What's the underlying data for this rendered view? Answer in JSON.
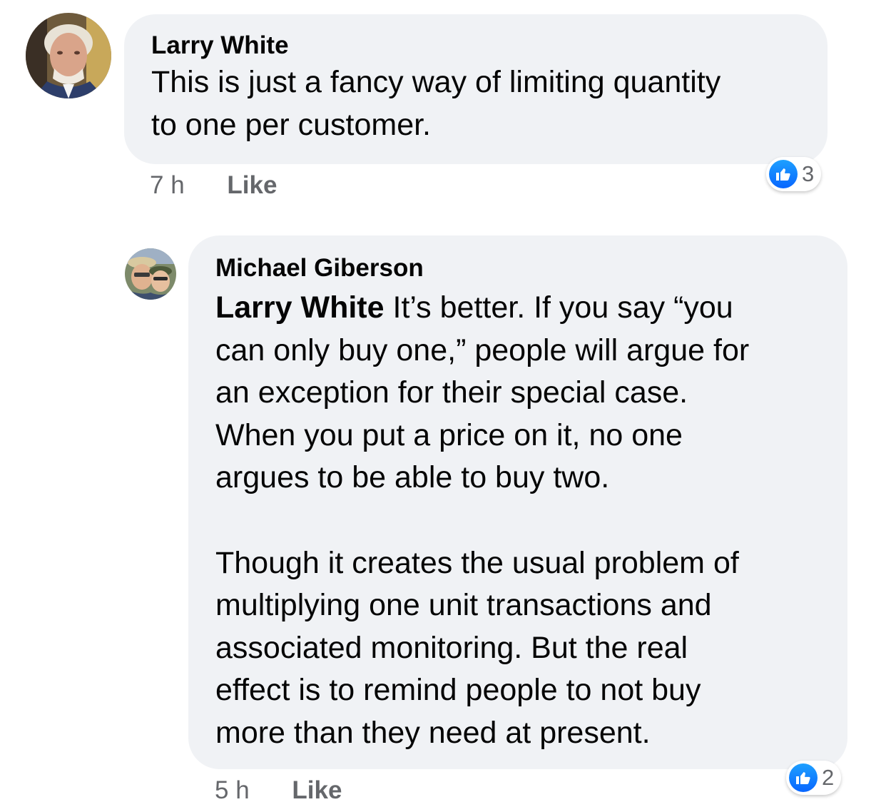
{
  "comments": [
    {
      "author": "Larry White",
      "text": "This is just a fancy way of limiting quantity\nto one per customer.",
      "time": "7 h",
      "like_label": "Like",
      "reaction_icon": "thumbs-up-icon",
      "reaction_count": "3"
    },
    {
      "author": "Michael Giberson",
      "mention": "Larry White",
      "text": " It’s better. If you say “you\ncan only buy one,” people will argue for\nan exception for their special case.\nWhen you put a price on it, no one\nargues to be able to buy two.\n\nThough it creates the usual problem of\nmultiplying one unit transactions and\nassociated monitoring. But the real\neffect is to remind people to not buy\nmore than they need at present.",
      "time": "5 h",
      "like_label": "Like",
      "reaction_icon": "thumbs-up-icon",
      "reaction_count": "2"
    }
  ],
  "colors": {
    "bubble": "#f0f2f5",
    "like_blue": "#0866ff",
    "meta_gray": "#65676b"
  }
}
